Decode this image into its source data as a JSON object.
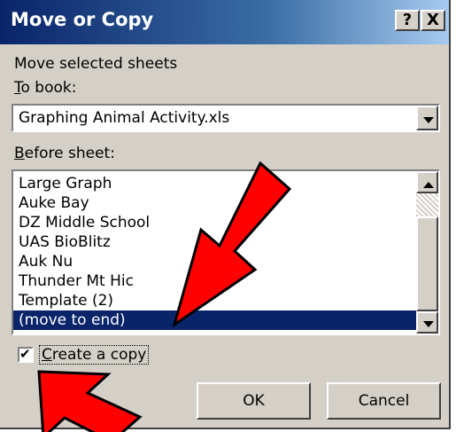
{
  "dialog": {
    "title": "Move or Copy",
    "help_label": "?",
    "close_label": "X",
    "intro_text": "Move selected sheets",
    "to_book": {
      "label_key": "T",
      "label_rest": "o book:",
      "value": "Graphing Animal Activity.xls"
    },
    "before_sheet": {
      "label_key": "B",
      "label_rest": "efore sheet:"
    },
    "sheets": [
      "Large Graph",
      "Auke Bay",
      "DZ Middle School",
      "UAS BioBlitz",
      "Auk Nu",
      "Thunder Mt Hic",
      "Template (2)",
      "(move to end)"
    ],
    "selected_index": 7,
    "create_copy": {
      "key": "C",
      "rest": "reate a copy",
      "checked": true
    },
    "ok_label": "OK",
    "cancel_label": "Cancel"
  },
  "colors": {
    "title_bar": "#0a246a",
    "selection": "#0a246a",
    "dialog_face": "#d4d0c8",
    "annotation_arrow": "#ff0000"
  },
  "icons": {
    "checkmark": "✔"
  }
}
